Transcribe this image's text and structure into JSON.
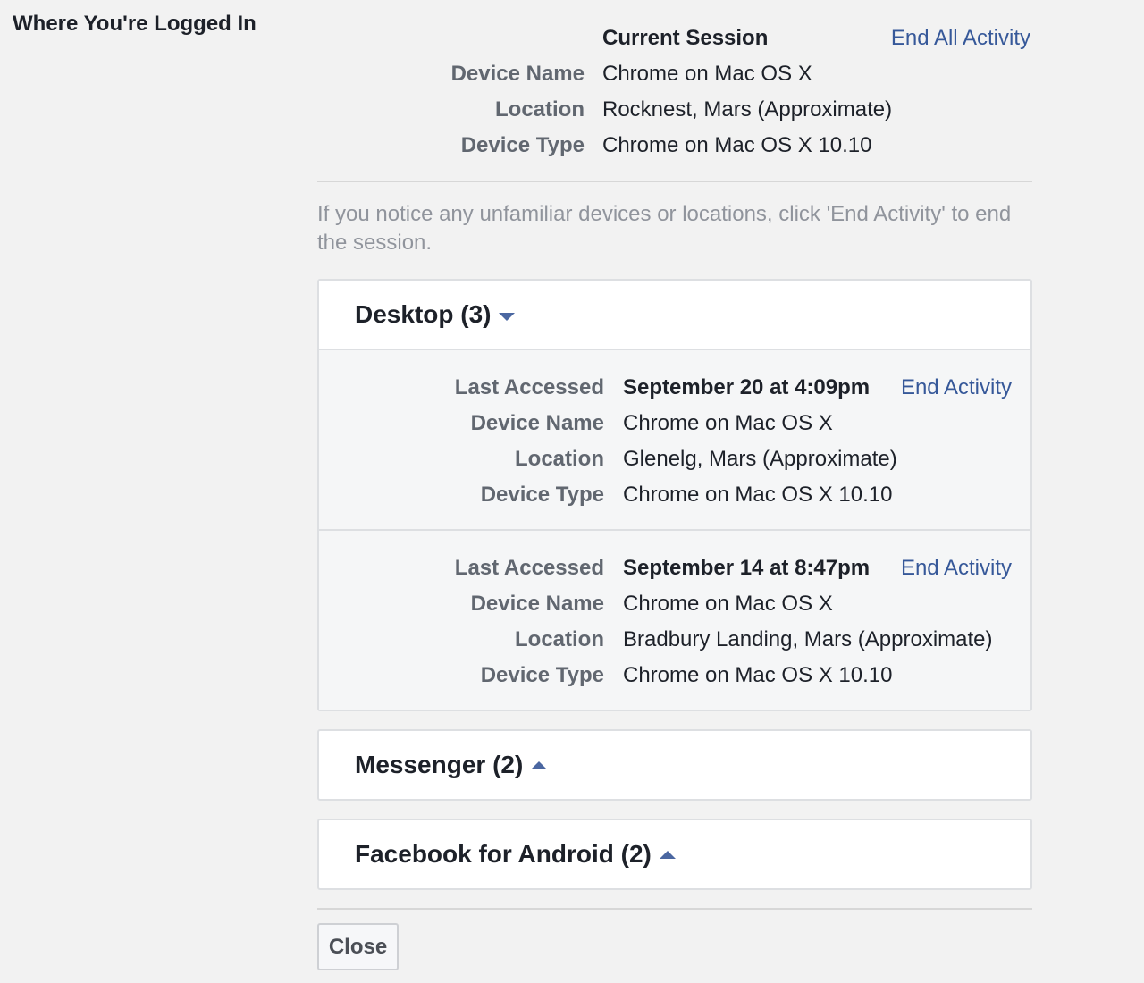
{
  "section_title": "Where You're Logged In",
  "current_session": {
    "heading": "Current Session",
    "end_all_label": "End All Activity",
    "rows": [
      {
        "label": "Device Name",
        "value": "Chrome on Mac OS X"
      },
      {
        "label": "Location",
        "value": "Rocknest, Mars (Approximate)"
      },
      {
        "label": "Device Type",
        "value": "Chrome on Mac OS X 10.10"
      }
    ]
  },
  "notice": "If you notice any unfamiliar devices or locations, click 'End Activity' to end the session.",
  "groups": [
    {
      "title": "Desktop (3)",
      "expanded": true,
      "sessions": [
        {
          "last_accessed_label": "Last Accessed",
          "last_accessed": "September 20 at 4:09pm",
          "end_label": "End Activity",
          "device_name_label": "Device Name",
          "device_name": "Chrome on Mac OS X",
          "location_label": "Location",
          "location": "Glenelg, Mars (Approximate)",
          "device_type_label": "Device Type",
          "device_type": "Chrome on Mac OS X 10.10"
        },
        {
          "last_accessed_label": "Last Accessed",
          "last_accessed": "September 14 at 8:47pm",
          "end_label": "End Activity",
          "device_name_label": "Device Name",
          "device_name": "Chrome on Mac OS X",
          "location_label": "Location",
          "location": "Bradbury Landing, Mars (Approximate)",
          "device_type_label": "Device Type",
          "device_type": "Chrome on Mac OS X 10.10"
        }
      ]
    },
    {
      "title": "Messenger (2)",
      "expanded": false
    },
    {
      "title": "Facebook for Android (2)",
      "expanded": false
    }
  ],
  "close_label": "Close",
  "colors": {
    "background": "#f2f2f2",
    "link": "#365899",
    "caret": "#4b67a1",
    "label": "#616770",
    "notice": "#90949c"
  },
  "icons": {
    "expanded": "caret-down-icon",
    "collapsed": "caret-up-icon"
  }
}
